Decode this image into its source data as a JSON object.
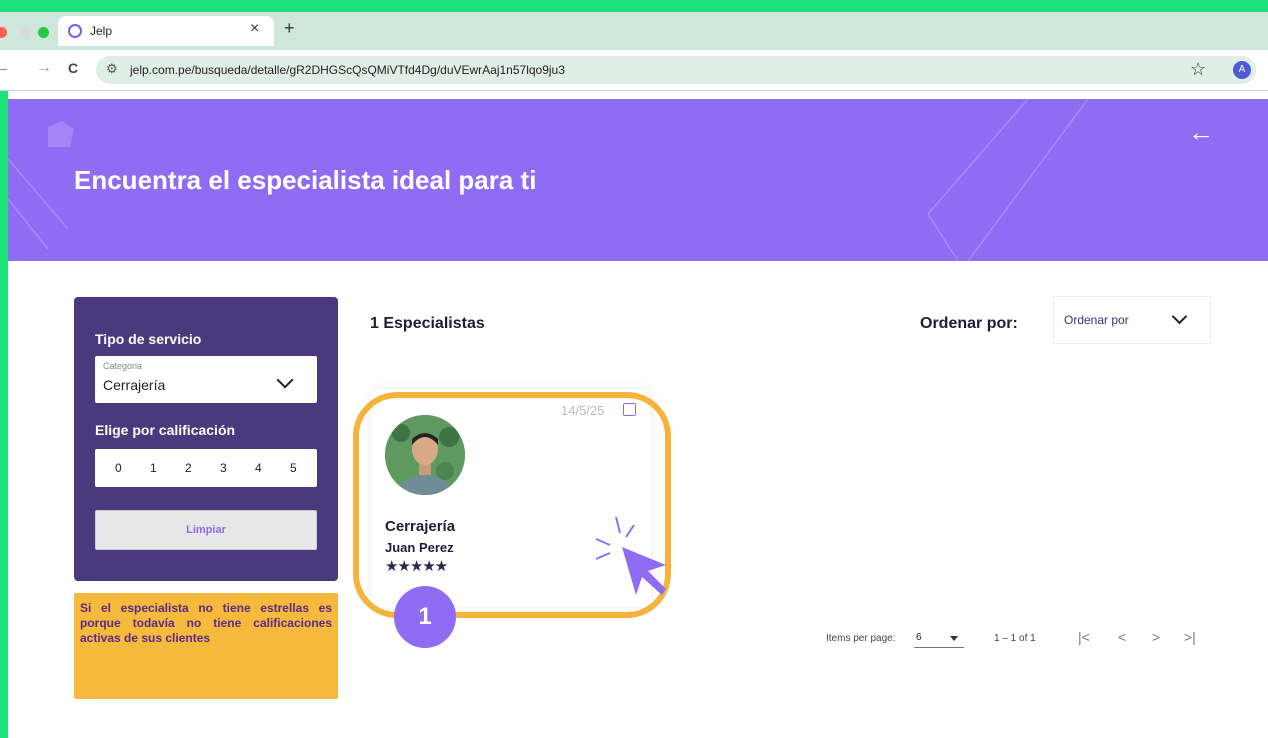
{
  "browser": {
    "tab_title": "Jelp",
    "tab_close": "×",
    "new_tab": "+",
    "nav_back": "←",
    "nav_forward": "→",
    "nav_reload": "C",
    "url": "jelp.com.pe/busqueda/detalle/gR2DHGScQsQMiVTfd4Dg/duVEwrAaj1n57lqo9ju3",
    "profile_initial": "A",
    "bookmark_star": "☆"
  },
  "hero": {
    "title": "Encuentra el especialista ideal para ti",
    "back_arrow": "←",
    "color": "#8f6cf4"
  },
  "sidebar": {
    "service_label": "Tipo de servicio",
    "category_small_label": "Categoria",
    "category_value": "Cerrajería",
    "rating_label": "Elige por calificación",
    "ratings": [
      "0",
      "1",
      "2",
      "3",
      "4",
      "5"
    ],
    "clear_button": "Limpiar",
    "note": "Si el especialista no tiene estrellas es porque todavía no tiene calificaciones activas de sus clientes"
  },
  "results": {
    "count_label": "1 Especialistas",
    "sort_label": "Ordenar por:",
    "sort_value": "Ordenar por"
  },
  "card": {
    "date": "14/5/25",
    "service": "Cerrajería",
    "name": "Juan Perez",
    "stars": "★★★★★",
    "rating": 5
  },
  "annotation": {
    "step": "1",
    "highlight_color": "#f6b33c",
    "badge_color": "#8f6cf4"
  },
  "pagination": {
    "items_label": "Items per page:",
    "page_size": "6",
    "range": "1 – 1 of 1",
    "first": "|<",
    "prev": "<",
    "next": ">",
    "last": ">|"
  }
}
